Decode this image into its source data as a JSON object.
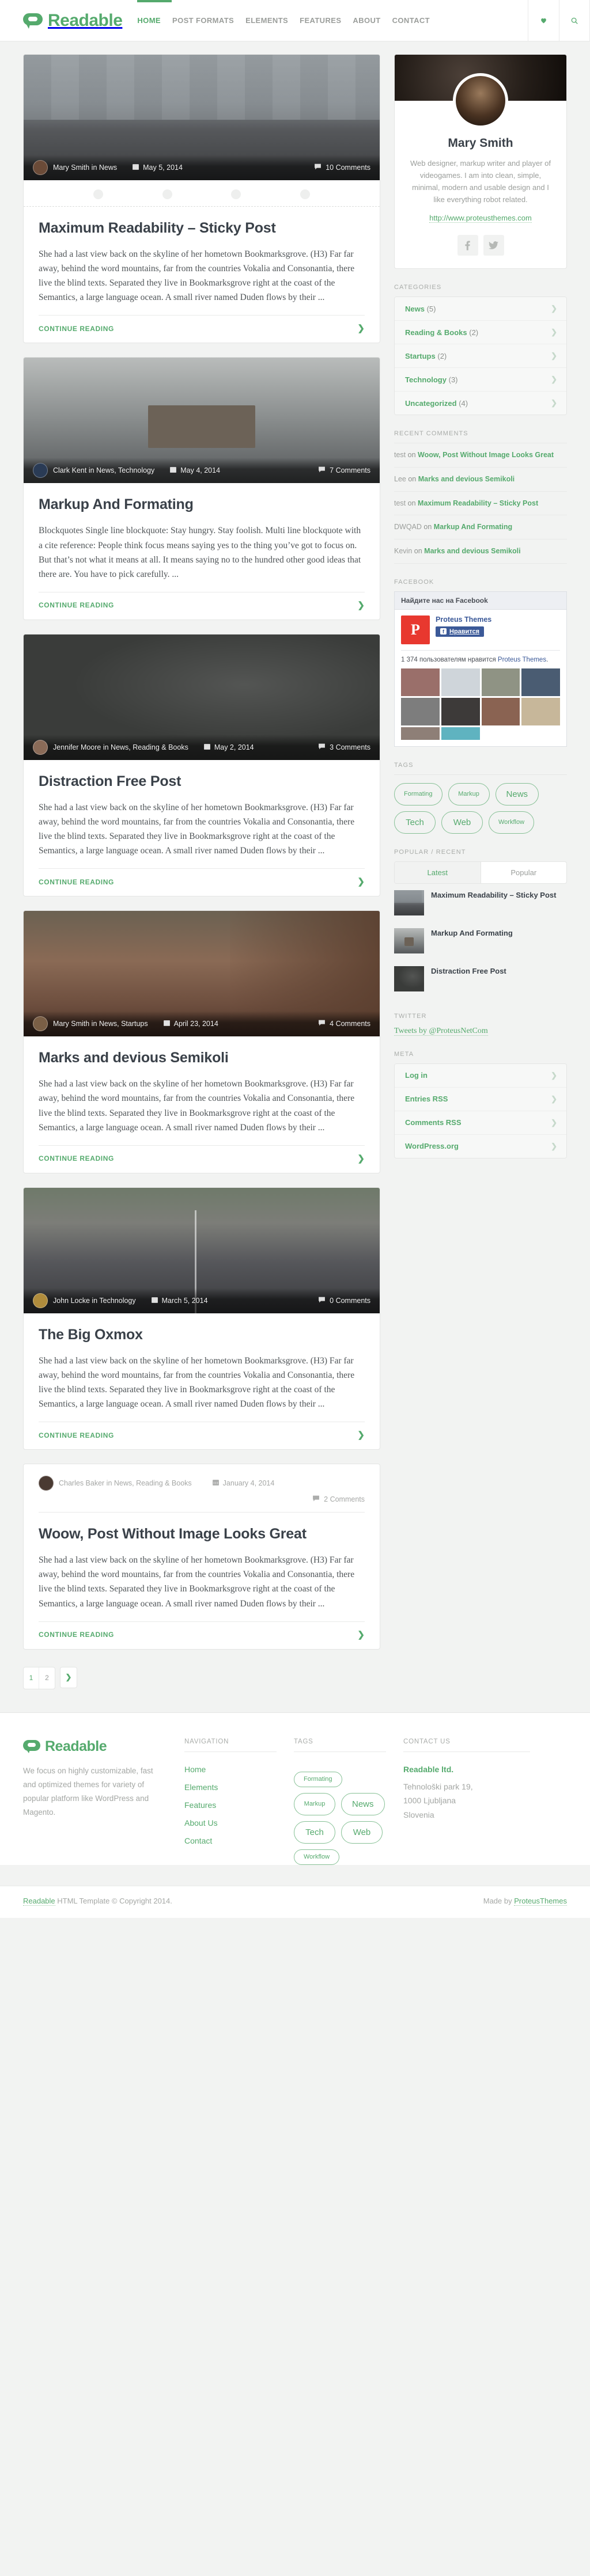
{
  "site": {
    "brand": "Readable"
  },
  "header": {
    "nav": [
      {
        "label": "HOME",
        "active": true
      },
      {
        "label": "POST FORMATS",
        "active": false
      },
      {
        "label": "ELEMENTS",
        "active": false
      },
      {
        "label": "FEATURES",
        "active": false
      },
      {
        "label": "ABOUT",
        "active": false
      },
      {
        "label": "CONTACT",
        "active": false
      }
    ],
    "actions": [
      {
        "name": "heart-icon",
        "glyph": "♥"
      },
      {
        "name": "search-icon",
        "glyph": "⌕"
      }
    ]
  },
  "posts": [
    {
      "author": "Mary Smith in News",
      "date": "May 5, 2014",
      "comments": "10 Comments",
      "title": "Maximum Readability – Sticky Post",
      "excerpt": "She had a last view back on the skyline of her hometown Bookmarksgrove. (H3) Far far away, behind the word mountains, far from the countries Vokalia and Consonantia, there live the blind texts. Separated they live in Bookmarksgrove right at the coast of the Semantics, a large language ocean. A small river named Duden flows by their ...",
      "continue": "CONTINUE READING",
      "media": "city-photo",
      "has_dots": true
    },
    {
      "author": "Clark Kent in News, Technology",
      "date": "May 4, 2014",
      "comments": "7 Comments",
      "title": "Markup And Formating",
      "excerpt": "Blockquotes Single line blockquote: Stay hungry. Stay foolish. Multi line blockquote with a cite reference: People think focus means saying yes to the thing you’ve got to focus on. But that’s not what it means at all. It means saying no to the hundred other good ideas that there are. You have to pick carefully. ...",
      "continue": "CONTINUE READING",
      "media": "books-photo",
      "has_dots": false
    },
    {
      "author": "Jennifer Moore in News, Reading & Books",
      "date": "May 2, 2014",
      "comments": "3 Comments",
      "title": "Distraction Free Post",
      "excerpt": "She had a last view back on the skyline of her hometown Bookmarksgrove. (H3) Far far away, behind the word mountains, far from the countries Vokalia and Consonantia, there live the blind texts. Separated they live in Bookmarksgrove right at the coast of the Semantics, a large language ocean. A small river named Duden flows by their ...",
      "continue": "CONTINUE READING",
      "media": "chalkboard-photo",
      "has_dots": false
    },
    {
      "author": "Mary Smith in News, Startups",
      "date": "April 23, 2014",
      "comments": "4 Comments",
      "title": "Marks and devious Semikoli",
      "excerpt": "She had a last view back on the skyline of her hometown Bookmarksgrove. (H3) Far far away, behind the word mountains, far from the countries Vokalia and Consonantia, there live the blind texts. Separated they live in Bookmarksgrove right at the coast of the Semantics, a large language ocean. A small river named Duden flows by their ...",
      "continue": "CONTINUE READING",
      "media": "canyon-photo",
      "has_dots": false
    },
    {
      "author": "John Locke in Technology",
      "date": "March 5, 2014",
      "comments": "0 Comments",
      "title": "The Big Oxmox",
      "excerpt": "She had a last view back on the skyline of her hometown Bookmarksgrove. (H3) Far far away, behind the word mountains, far from the countries Vokalia and Consonantia, there live the blind texts. Separated they live in Bookmarksgrove right at the coast of the Semantics, a large language ocean. A small river named Duden flows by their ...",
      "continue": "CONTINUE READING",
      "media": "road-photo",
      "has_dots": false
    },
    {
      "author": "Charles Baker in News, Reading & Books",
      "date": "January 4, 2014",
      "comments": "2 Comments",
      "title": "Woow, Post Without Image Looks Great",
      "excerpt": "She had a last view back on the skyline of her hometown Bookmarksgrove. (H3) Far far away, behind the word mountains, far from the countries Vokalia and Consonantia, there live the blind texts. Separated they live in Bookmarksgrove right at the coast of the Semantics, a large language ocean. A small river named Duden flows by their ...",
      "continue": "CONTINUE READING",
      "media": "none",
      "has_dots": false
    }
  ],
  "pagination": {
    "pages": [
      "1",
      "2"
    ],
    "active": "1",
    "next_glyph": "❯"
  },
  "sidebar": {
    "profile": {
      "name": "Mary Smith",
      "bio": "Web designer, markup writer and player of videogames. I am into clean, simple, minimal, modern and usable design and I like everything robot related.",
      "link": "http://www.proteusthemes.com",
      "socials": [
        "facebook-icon",
        "twitter-icon"
      ]
    },
    "categories": {
      "title": "CATEGORIES",
      "items": [
        {
          "label": "News",
          "count": "(5)"
        },
        {
          "label": "Reading & Books",
          "count": "(2)"
        },
        {
          "label": "Startups",
          "count": "(2)"
        },
        {
          "label": "Technology",
          "count": "(3)"
        },
        {
          "label": "Uncategorized",
          "count": "(4)"
        }
      ]
    },
    "recent_comments": {
      "title": "RECENT COMMENTS",
      "items": [
        {
          "who": "test",
          "on": "on",
          "post": "Woow, Post Without Image Looks Great"
        },
        {
          "who": "Lee",
          "on": "on",
          "post": "Marks and devious Semikoli"
        },
        {
          "who": "test",
          "on": "on",
          "post": "Maximum Readability – Sticky Post"
        },
        {
          "who": "DWQAD",
          "on": "on",
          "post": "Markup And Formating"
        },
        {
          "who": "Kevin",
          "on": "on",
          "post": "Marks and devious Semikoli"
        }
      ]
    },
    "facebook": {
      "title": "FACEBOOK",
      "header": "Найдите нас на Facebook",
      "page_name": "Proteus Themes",
      "like_label": "Нравится",
      "logo_letter": "P",
      "count_text": "1 374 пользователям нравится",
      "count_link": "Proteus Themes"
    },
    "tags": {
      "title": "TAGS",
      "items": [
        {
          "label": "Formating",
          "size": "s1"
        },
        {
          "label": "Markup",
          "size": "s1"
        },
        {
          "label": "News",
          "size": "s2"
        },
        {
          "label": "Tech",
          "size": "s2"
        },
        {
          "label": "Web",
          "size": "s2"
        },
        {
          "label": "Workflow",
          "size": "s3"
        }
      ]
    },
    "popular_recent": {
      "title": "POPULAR / RECENT",
      "tabs": [
        {
          "label": "Latest",
          "active": true
        },
        {
          "label": "Popular",
          "active": false
        }
      ],
      "items": [
        {
          "title": "Maximum Readability – Sticky Post",
          "thumb": "city-thumb"
        },
        {
          "title": "Markup And Formating",
          "thumb": "books-thumb"
        },
        {
          "title": "Distraction Free Post",
          "thumb": "chalk-thumb"
        }
      ]
    },
    "twitter": {
      "title": "TWITTER",
      "link": "Tweets by @ProteusNetCom"
    },
    "meta": {
      "title": "META",
      "items": [
        {
          "label": "Log in"
        },
        {
          "label": "Entries RSS"
        },
        {
          "label": "Comments RSS"
        },
        {
          "label": "WordPress.org"
        }
      ]
    }
  },
  "footer": {
    "brand": "Readable",
    "about": "We focus on highly customizable, fast and optimized themes for variety of popular platform like WordPress and Magento.",
    "navigation": {
      "title": "NAVIGATION",
      "items": [
        "Home",
        "Elements",
        "Features",
        "About Us",
        "Contact"
      ]
    },
    "tags": {
      "title": "TAGS",
      "items": [
        {
          "label": "Formating",
          "size": "s1"
        },
        {
          "label": "Markup",
          "size": "s1"
        },
        {
          "label": "News",
          "size": "s2"
        },
        {
          "label": "Tech",
          "size": "s2"
        },
        {
          "label": "Web",
          "size": "s2"
        },
        {
          "label": "Workflow",
          "size": "s3"
        }
      ]
    },
    "contact": {
      "title": "CONTACT US",
      "company": "Readable ltd.",
      "lines": [
        "Tehnološki park 19,",
        "1000 Ljubljana",
        "Slovenia"
      ]
    },
    "copyright_link": "Readable",
    "copyright_text": " HTML Template © Copyright 2014.",
    "made_by_text": "Made by ",
    "made_by_link": "ProteusThemes"
  },
  "colors": {
    "accent": "#55aa6d",
    "heading": "#3a4149",
    "muted": "#9b9e9b",
    "page_bg": "#f2f3f2"
  }
}
